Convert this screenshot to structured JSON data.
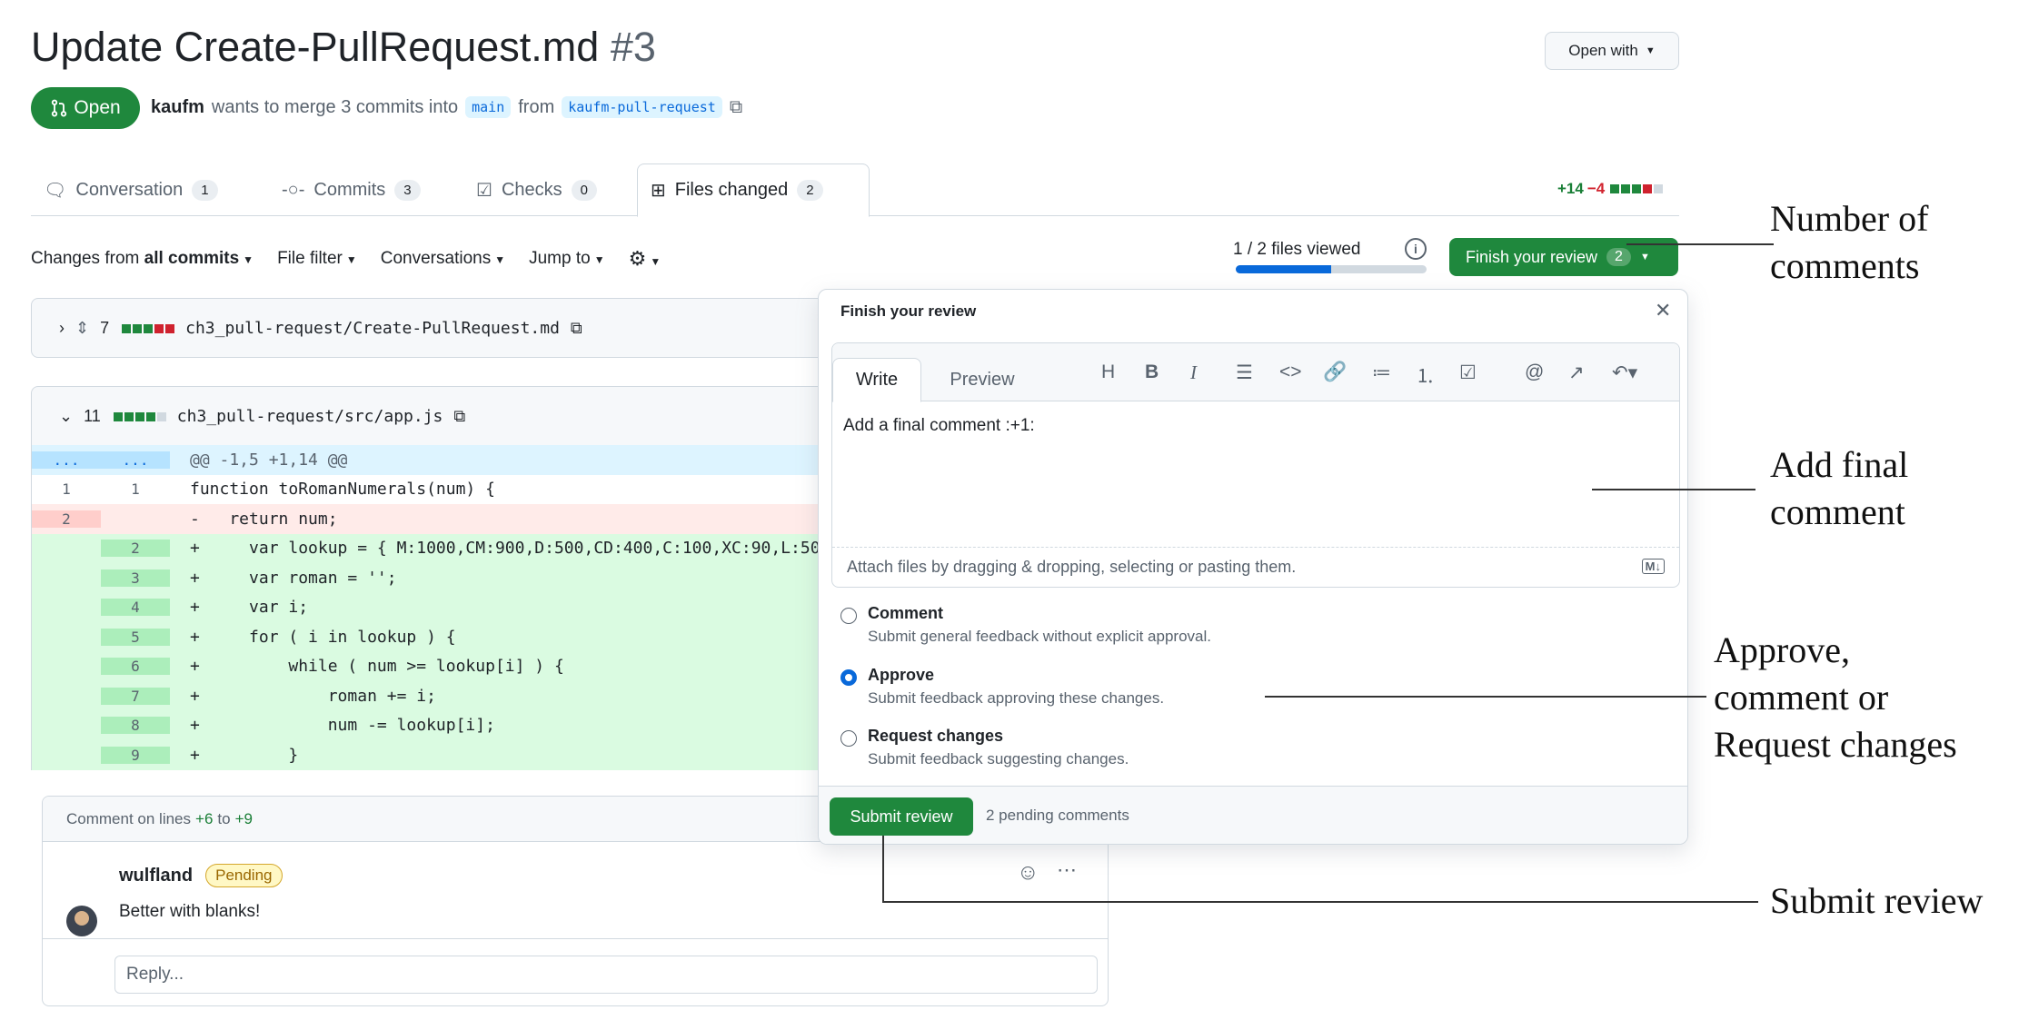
{
  "pr": {
    "title": "Update Create-PullRequest.md",
    "number": "#3",
    "state": "Open",
    "author": "kaufm",
    "merge_text": "wants to merge 3 commits into",
    "base_branch": "main",
    "from_text": "from",
    "head_branch": "kaufm-pull-request",
    "open_with": "Open with"
  },
  "tabs": [
    {
      "label": "Conversation",
      "count": "1",
      "icon": "comment-discussion-icon"
    },
    {
      "label": "Commits",
      "count": "3",
      "icon": "git-commit-icon"
    },
    {
      "label": "Checks",
      "count": "0",
      "icon": "checklist-icon"
    },
    {
      "label": "Files changed",
      "count": "2",
      "icon": "file-diff-icon"
    }
  ],
  "diffstat": {
    "additions": "+14",
    "deletions": "−4"
  },
  "toolbar": {
    "changes_prefix": "Changes from",
    "changes_value": "all commits",
    "file_filter": "File filter",
    "conversations": "Conversations",
    "jump_to": "Jump to",
    "files_viewed": "1 / 2 files viewed",
    "files_viewed_fraction": 0.5,
    "finish_label": "Finish your review",
    "finish_count": "2"
  },
  "files": [
    {
      "count": "7",
      "path": "ch3_pull-request/Create-PullRequest.md"
    },
    {
      "count": "11",
      "path": "ch3_pull-request/src/app.js"
    }
  ],
  "diff": {
    "hunk": "@@ -1,5 +1,14 @@",
    "hunk_left": "...",
    "hunk_right": "...",
    "lines": [
      {
        "type": "ctx",
        "old": "1",
        "new": "1",
        "code": "function toRomanNumerals(num) {"
      },
      {
        "type": "del",
        "old": "2",
        "new": "",
        "code": "-   return num;"
      },
      {
        "type": "add",
        "old": "",
        "new": "2",
        "code": "+     var lookup = { M:1000,CM:900,D:500,CD:400,C:100,XC:90,L:50"
      },
      {
        "type": "add",
        "old": "",
        "new": "3",
        "code": "+     var roman = '';"
      },
      {
        "type": "add",
        "old": "",
        "new": "4",
        "code": "+     var i;"
      },
      {
        "type": "add",
        "old": "",
        "new": "5",
        "code": "+     for ( i in lookup ) {"
      },
      {
        "type": "add",
        "old": "",
        "new": "6",
        "code": "+         while ( num >= lookup[i] ) {"
      },
      {
        "type": "add",
        "old": "",
        "new": "7",
        "code": "+             roman += i;"
      },
      {
        "type": "add",
        "old": "",
        "new": "8",
        "code": "+             num -= lookup[i];"
      },
      {
        "type": "add",
        "old": "",
        "new": "9",
        "code": "+         }"
      }
    ]
  },
  "thread": {
    "header_prefix": "Comment on lines",
    "from_line": "+6",
    "to_text": "to",
    "to_line": "+9",
    "user": "wulfland",
    "badge": "Pending",
    "body": "Better with blanks!",
    "reply_placeholder": "Reply..."
  },
  "review": {
    "title": "Finish your review",
    "tab_write": "Write",
    "tab_preview": "Preview",
    "comment_text": "Add a final comment :+1:",
    "attach_text": "Attach files by dragging & dropping, selecting or pasting them.",
    "md_badge": "M↓",
    "options": [
      {
        "label": "Comment",
        "desc": "Submit general feedback without explicit approval.",
        "selected": false
      },
      {
        "label": "Approve",
        "desc": "Submit feedback approving these changes.",
        "selected": true
      },
      {
        "label": "Request changes",
        "desc": "Submit feedback suggesting changes.",
        "selected": false
      }
    ],
    "submit_label": "Submit review",
    "pending_text": "2 pending comments"
  },
  "annotations": {
    "number_of_comments": [
      "Number of",
      "comments"
    ],
    "add_final_comment": [
      "Add final",
      "comment"
    ],
    "approve": [
      "Approve,",
      "comment or",
      "Request changes"
    ],
    "submit_review": "Submit review"
  },
  "colors": {
    "accent_green": "#1f883d",
    "link_blue": "#0969da",
    "add_bg": "#dafbe1",
    "del_bg": "#ffebe9"
  }
}
